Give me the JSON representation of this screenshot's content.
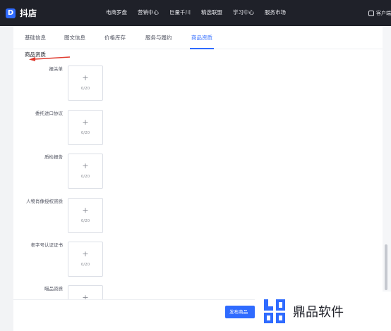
{
  "app": {
    "logo_text": "抖店",
    "logo_mark": "D"
  },
  "top_nav": {
    "items": [
      "电商罗盘",
      "营销中心",
      "巨量千川",
      "精选联盟",
      "学习中心",
      "服务市场"
    ],
    "right_label": "客户端"
  },
  "tabs": {
    "items": [
      "基础信息",
      "图文信息",
      "价格库存",
      "服务与履约",
      "商品资质"
    ],
    "active_index": 4
  },
  "section": {
    "title": "商品资质"
  },
  "uploads": [
    {
      "label": "报关单",
      "plus": "+",
      "count": "0/20"
    },
    {
      "label": "委托进口协议",
      "plus": "+",
      "count": "0/20"
    },
    {
      "label": "质检报告",
      "plus": "+",
      "count": "0/20"
    },
    {
      "label": "人物肖像授权资质",
      "plus": "+",
      "count": "0/20"
    },
    {
      "label": "老字号认证证书",
      "plus": "+",
      "count": "0/20"
    },
    {
      "label": "瞄品资质",
      "plus": "+",
      "count": ""
    }
  ],
  "footer": {
    "publish_label": "发布商品"
  },
  "watermark": {
    "text": "鼎品软件"
  },
  "colors": {
    "accent": "#2f6bff",
    "topbar": "#1f2129",
    "arrow": "#e03b2f"
  }
}
